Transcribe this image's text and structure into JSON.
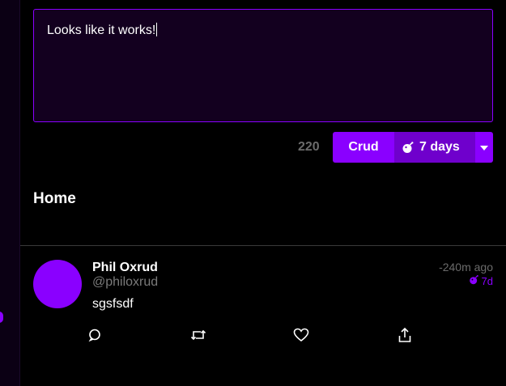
{
  "composer": {
    "text": "Looks like it works!",
    "char_count": "220"
  },
  "submit": {
    "crud_label": "Crud",
    "expiry_label": "7 days"
  },
  "feed": {
    "title": "Home"
  },
  "post": {
    "author_name": "Phil Oxrud",
    "author_handle": "@philoxrud",
    "time": "-240m ago",
    "expiry": "7d",
    "body": "sgsfsdf"
  },
  "colors": {
    "accent": "#8a00ff",
    "accent_dark": "#6f00cc",
    "composer_bg": "#13001f",
    "muted": "#6b6b6b"
  },
  "icons": {
    "expiry": "bomb-icon",
    "dropdown": "caret-down-icon",
    "reply": "comment-icon",
    "repost": "retweet-icon",
    "like": "heart-icon",
    "share": "share-icon"
  }
}
